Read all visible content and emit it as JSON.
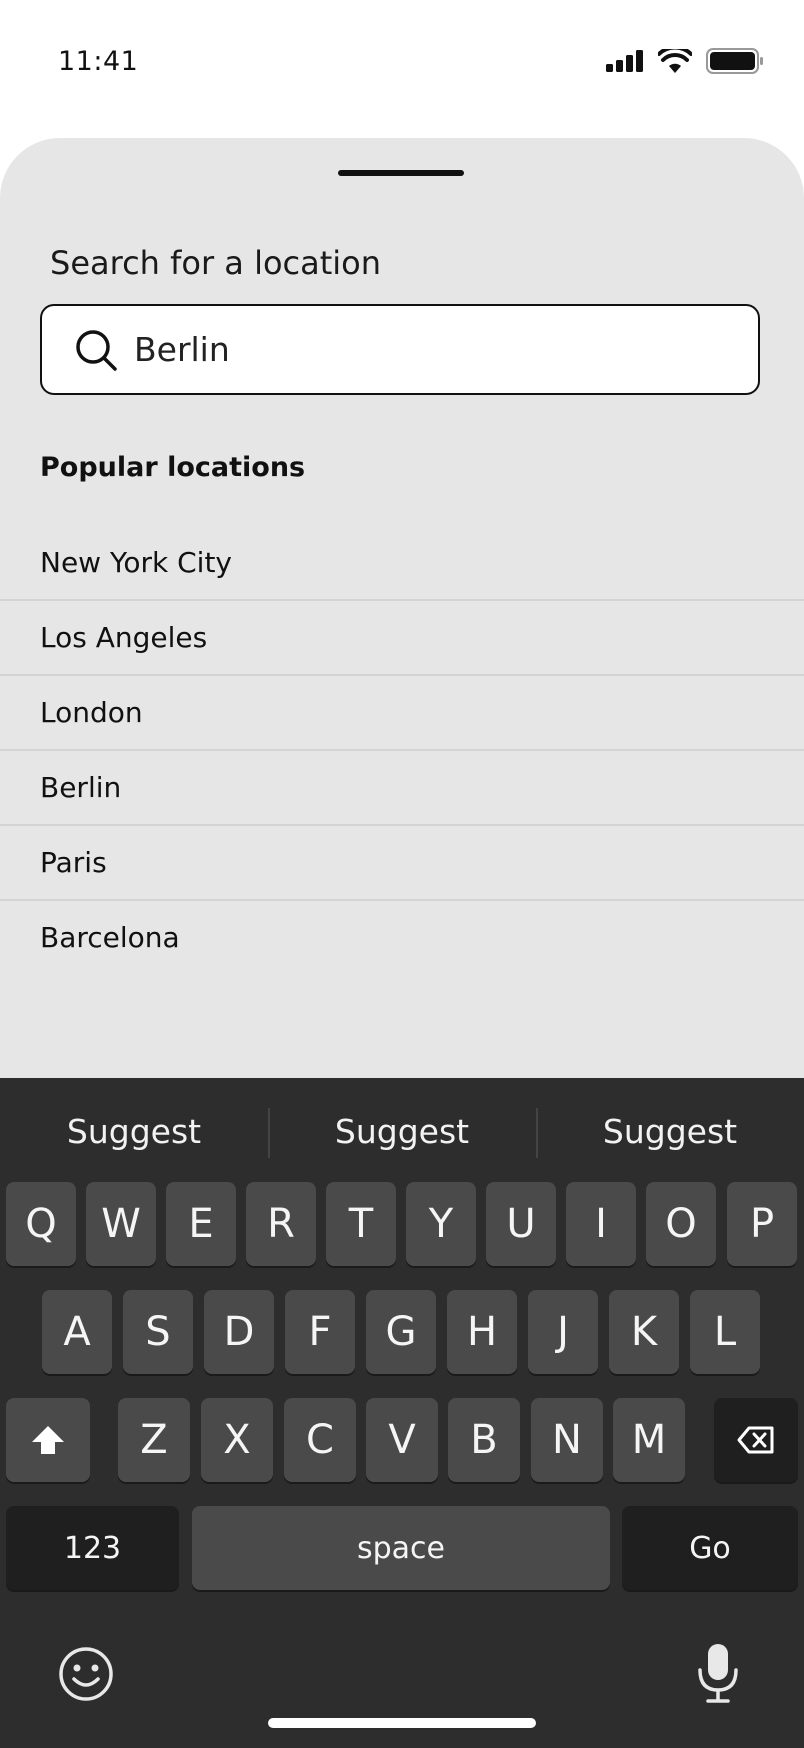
{
  "status": {
    "time": "11:41"
  },
  "sheet": {
    "title": "Search for a location",
    "search": {
      "value": "Berlin",
      "placeholder": ""
    },
    "section_title": "Popular locations",
    "locations": [
      "New York City",
      "Los Angeles",
      "London",
      "Berlin",
      "Paris",
      "Barcelona"
    ]
  },
  "keyboard": {
    "suggestions": [
      "Suggest",
      "Suggest",
      "Suggest"
    ],
    "row1": [
      "Q",
      "W",
      "E",
      "R",
      "T",
      "Y",
      "U",
      "I",
      "O",
      "P"
    ],
    "row2": [
      "A",
      "S",
      "D",
      "F",
      "G",
      "H",
      "J",
      "K",
      "L"
    ],
    "row3": [
      "Z",
      "X",
      "C",
      "V",
      "B",
      "N",
      "M"
    ],
    "numbers_label": "123",
    "space_label": "space",
    "go_label": "Go",
    "icons": {
      "shift": "shift-arrow-icon",
      "delete": "backspace-icon",
      "emoji": "smiley-icon",
      "mic": "microphone-icon"
    }
  }
}
